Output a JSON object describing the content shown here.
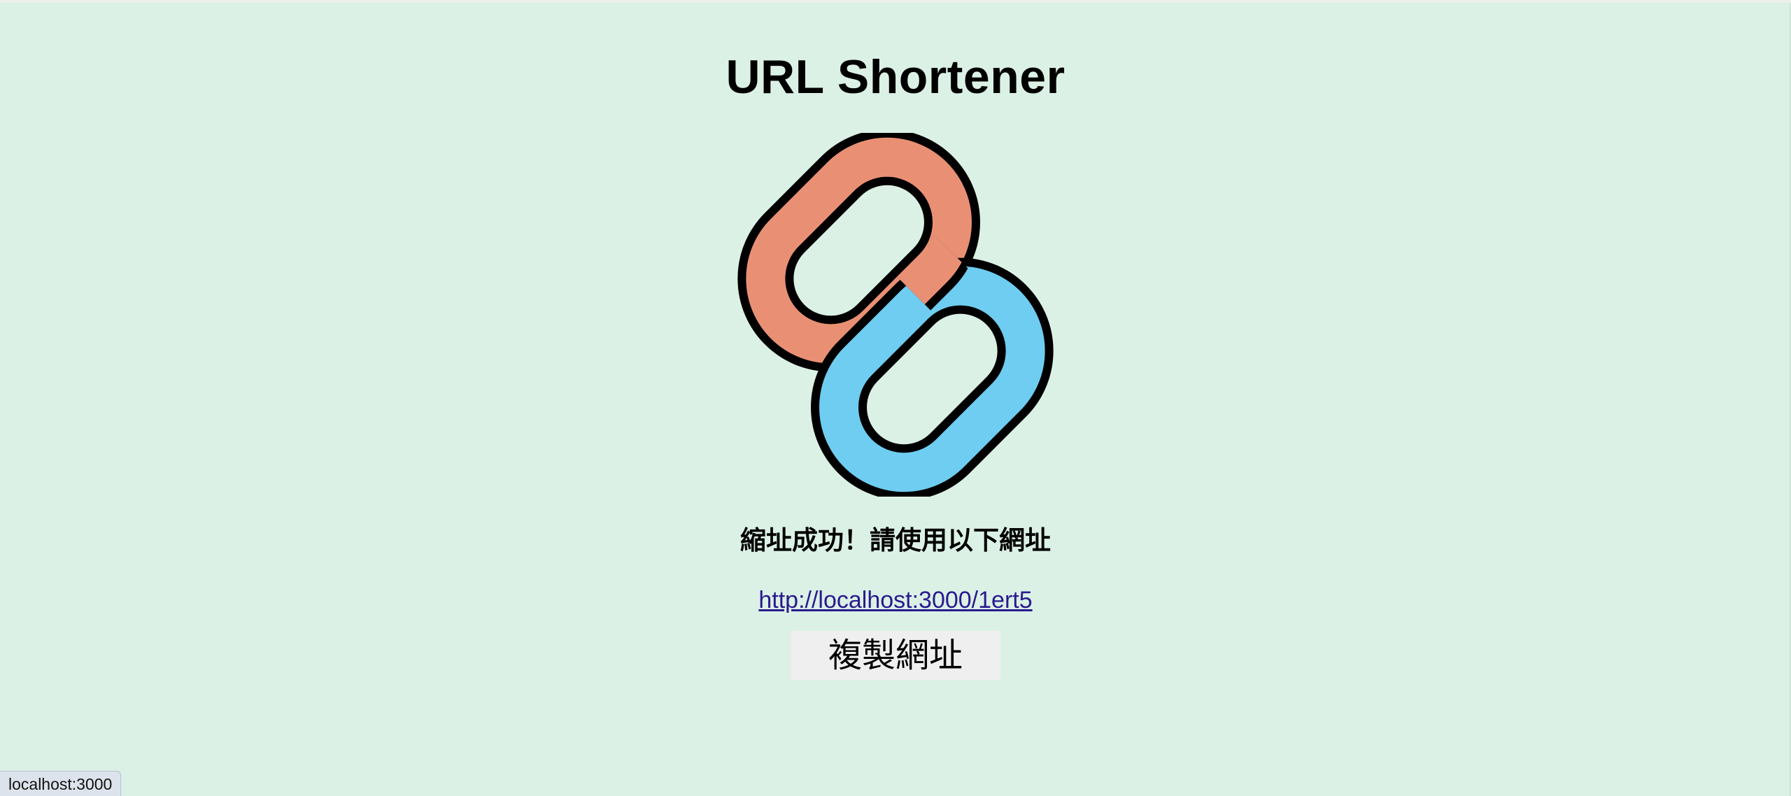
{
  "page": {
    "title": "URL Shortener"
  },
  "logo": {
    "icon": "chain-link-icon",
    "colors": {
      "left_link": "#6ecdf0",
      "right_link": "#e99074",
      "outline": "#000000"
    }
  },
  "result": {
    "message": "縮址成功！請使用以下網址",
    "short_url": "http://localhost:3000/1ert5"
  },
  "actions": {
    "copy_label": "複製網址"
  },
  "status_bar": {
    "url": "localhost:3000"
  },
  "colors": {
    "background": "#dbf1e5",
    "link": "#2a1a8f",
    "button_bg": "#efefef"
  }
}
